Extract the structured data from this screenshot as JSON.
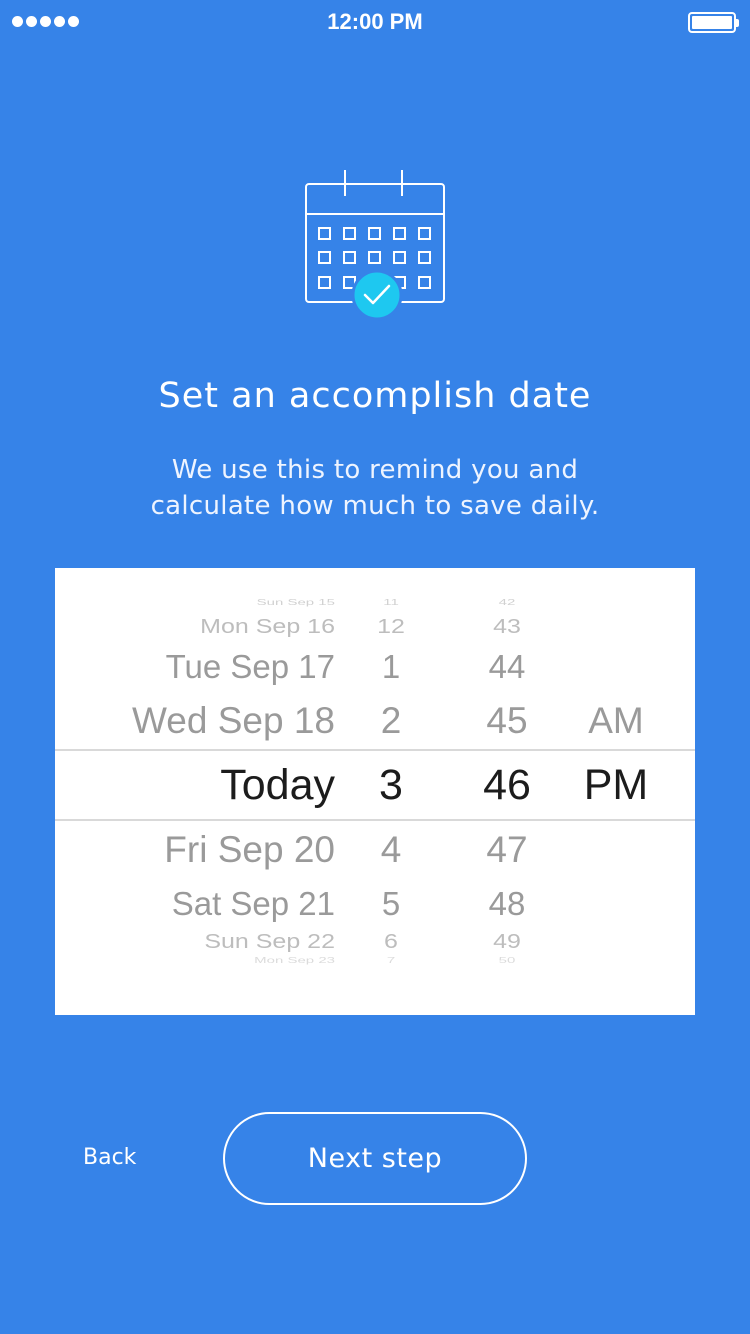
{
  "status_bar": {
    "time": "12:00 PM",
    "signal_bars": 5,
    "battery_level": 1.0
  },
  "header": {
    "icon": "calendar-check-icon",
    "title": "Set an accomplish date",
    "subtitle_line1": "We use this to remind you and",
    "subtitle_line2": "calculate how much to save daily."
  },
  "picker": {
    "selected_index": 7,
    "rows": [
      {
        "date": "Sun Sep 15",
        "hour": "11",
        "minute": "42",
        "ampm": ""
      },
      {
        "date": "Mon Sep 16",
        "hour": "12",
        "minute": "43",
        "ampm": ""
      },
      {
        "date": "Tue Sep 17",
        "hour": "1",
        "minute": "44",
        "ampm": ""
      },
      {
        "date": "Wed Sep 18",
        "hour": "2",
        "minute": "45",
        "ampm": "AM"
      },
      {
        "date": "Today",
        "hour": "3",
        "minute": "46",
        "ampm": "PM"
      },
      {
        "date": "Fri Sep 20",
        "hour": "4",
        "minute": "47",
        "ampm": ""
      },
      {
        "date": "Sat Sep 21",
        "hour": "5",
        "minute": "48",
        "ampm": ""
      },
      {
        "date": "Sun Sep 22",
        "hour": "6",
        "minute": "49",
        "ampm": ""
      },
      {
        "date": "Mon Sep 23",
        "hour": "7",
        "minute": "50",
        "ampm": ""
      }
    ]
  },
  "actions": {
    "back_label": "Back",
    "next_label": "Next step"
  },
  "colors": {
    "background": "#3683e8",
    "check_badge": "#1ec8f0",
    "picker_bg": "#ffffff"
  }
}
